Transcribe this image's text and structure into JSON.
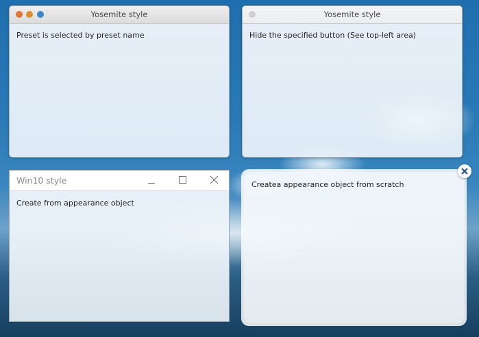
{
  "windows": {
    "top_left": {
      "title": "Yosemite style",
      "body": "Preset is selected by preset name",
      "buttons": [
        {
          "name": "close",
          "color": "#e0733a"
        },
        {
          "name": "minimize",
          "color": "#e09a3a"
        },
        {
          "name": "zoom",
          "color": "#3d86c6"
        }
      ]
    },
    "top_right": {
      "title": "Yosemite style",
      "body": "Hide the specified button (See top-left area)",
      "buttons": [
        {
          "name": "close",
          "color": "#d0d0d0"
        }
      ]
    },
    "bottom_left": {
      "title": "Win10 style",
      "body": "Create from appearance object",
      "controls": [
        "minimize-icon",
        "maximize-icon",
        "close-icon"
      ]
    },
    "bottom_right": {
      "body": "Createa appearance object from scratch",
      "close_icon": "close-icon"
    }
  },
  "colors": {
    "yosemite_close": "#e0733a",
    "yosemite_minimize": "#e09a3a",
    "yosemite_zoom": "#3d86c6",
    "scratch_close": "#1e4f7a"
  }
}
